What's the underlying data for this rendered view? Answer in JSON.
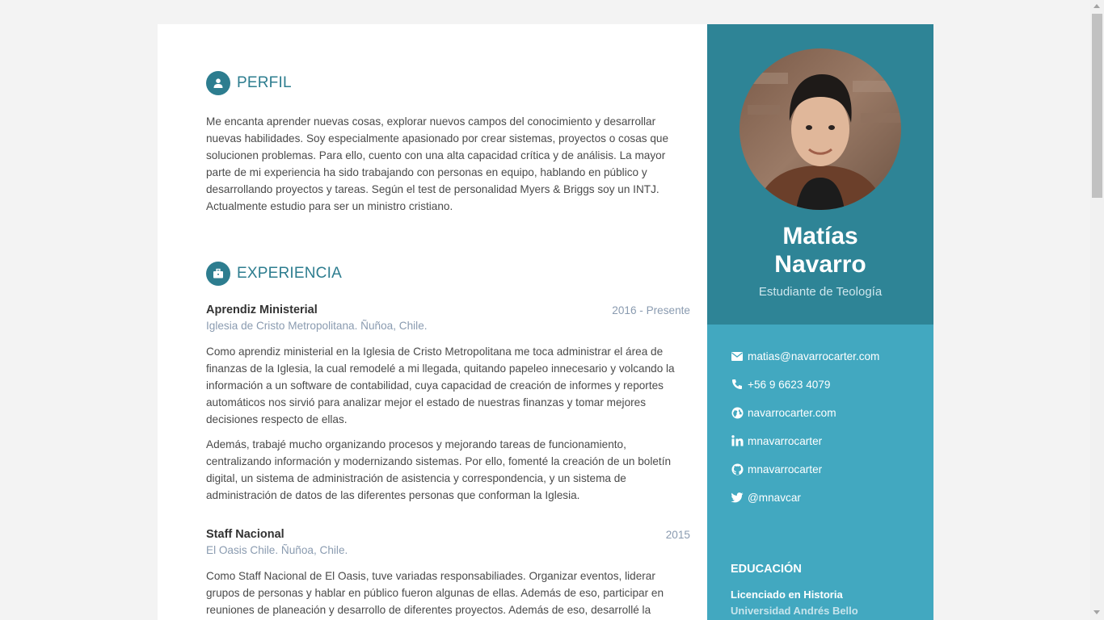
{
  "profile": {
    "heading": "PERFIL",
    "icon": "user-icon",
    "text": "Me encanta aprender nuevas cosas, explorar nuevos campos del conocimiento y desarrollar nuevas habilidades. Soy especialmente apasionado por crear sistemas, proyectos o cosas que solucionen problemas. Para ello, cuento con una alta capacidad crítica y de análisis. La mayor parte de mi experiencia ha sido trabajando con personas en equipo, hablando en público y desarrollando proyectos y tareas. Según el test de personalidad Myers & Briggs soy un INTJ. Actualmente estudio para ser un ministro cristiano."
  },
  "experience": {
    "heading": "EXPERIENCIA",
    "icon": "briefcase-icon",
    "jobs": [
      {
        "title": "Aprendiz Ministerial",
        "date": "2016 - Presente",
        "org": "Iglesia de Cristo Metropolitana. Ñuñoa, Chile.",
        "paragraphs": [
          "Como aprendiz ministerial en la Iglesia de Cristo Metropolitana me toca administrar el área de finanzas de la Iglesia, la cual remodelé a mi llegada, quitando papeleo innecesario y volcando la información a un software de contabilidad, cuya capacidad de creación de informes y reportes automáticos nos sirvió para analizar mejor el estado de nuestras finanzas y tomar mejores decisiones respecto de ellas.",
          "Además, trabajé mucho organizando procesos y mejorando tareas de funcionamiento, centralizando información y modernizando sistemas. Por ello, fomenté la creación de un boletín digital, un sistema de administración de asistencia y correspondencia, y un sistema de administración de datos de las diferentes personas que conforman la Iglesia."
        ]
      },
      {
        "title": "Staff Nacional",
        "date": "2015",
        "org": "El Oasis Chile. Ñuñoa, Chile.",
        "paragraphs": [
          "Como Staff Nacional de El Oasis, tuve variadas responsabiliades. Organizar eventos, liderar grupos de personas y hablar en público fueron algunas de ellas. Además de eso, participar en reuniones de planeación y desarrollo de diferentes proyectos. Además de eso, desarrollé la"
        ]
      }
    ]
  },
  "sidebar": {
    "name_line1": "Matías",
    "name_line2": "Navarro",
    "role": "Estudiante de Teología",
    "contacts": [
      {
        "icon": "envelope-icon",
        "text": "matias@navarrocarter.com"
      },
      {
        "icon": "phone-icon",
        "text": "+56 9 6623 4079"
      },
      {
        "icon": "globe-icon",
        "text": "navarrocarter.com"
      },
      {
        "icon": "linkedin-icon",
        "text": "mnavarrocarter"
      },
      {
        "icon": "github-icon",
        "text": "mnavarrocarter"
      },
      {
        "icon": "twitter-icon",
        "text": "@mnavcar"
      }
    ],
    "education": {
      "heading": "EDUCACIÓN",
      "degree": "Licenciado en Historia",
      "school": "Universidad Andrés Bello"
    }
  },
  "colors": {
    "accent": "#2d7d8f",
    "sidebar_dark": "#2e8496",
    "sidebar_light": "#42a8c0",
    "muted": "#8a9bb0"
  }
}
